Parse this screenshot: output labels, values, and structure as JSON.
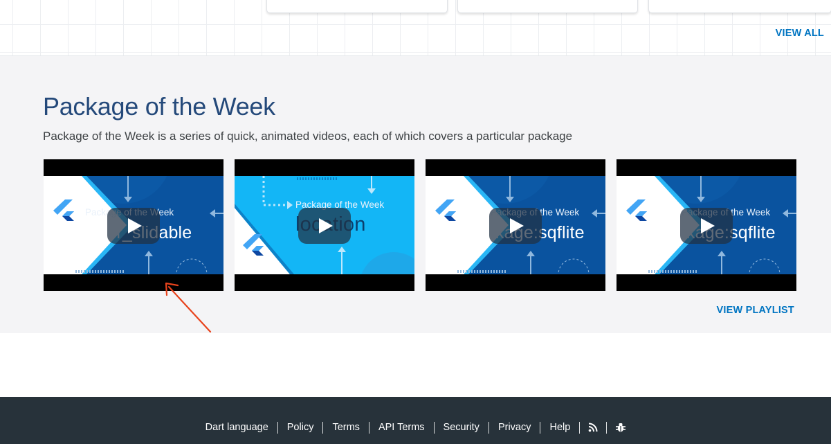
{
  "top": {
    "view_all": "VIEW ALL"
  },
  "section": {
    "title": "Package of the Week",
    "description": "Package of the Week is a series of quick, animated videos, each of which covers a particular package",
    "videos": [
      {
        "small": "Package of the Week",
        "name": "flutter_slidable",
        "theme": "dark",
        "icon": "flutter-logo"
      },
      {
        "small": "Package of the Week",
        "name": "location",
        "theme": "light",
        "icon": "flutter-logo"
      },
      {
        "small": "Package of the Week",
        "name": "package:sqflite",
        "theme": "dark",
        "icon": "flutter-logo"
      },
      {
        "small": "Package of the Week",
        "name": "package:sqflite",
        "theme": "dark",
        "icon": "flutter-logo"
      }
    ],
    "view_playlist": "VIEW PLAYLIST"
  },
  "footer": {
    "links": [
      "Dart language",
      "Policy",
      "Terms",
      "API Terms",
      "Security",
      "Privacy",
      "Help"
    ],
    "icons": [
      "rss-icon",
      "bug-icon"
    ]
  },
  "colors": {
    "link_blue": "#0175c2",
    "title_blue": "#24497a",
    "dark_thumb": "#0a539f",
    "light_thumb": "#13b6f6",
    "footer_bg": "#27323a",
    "annotation": "#e8431c"
  }
}
